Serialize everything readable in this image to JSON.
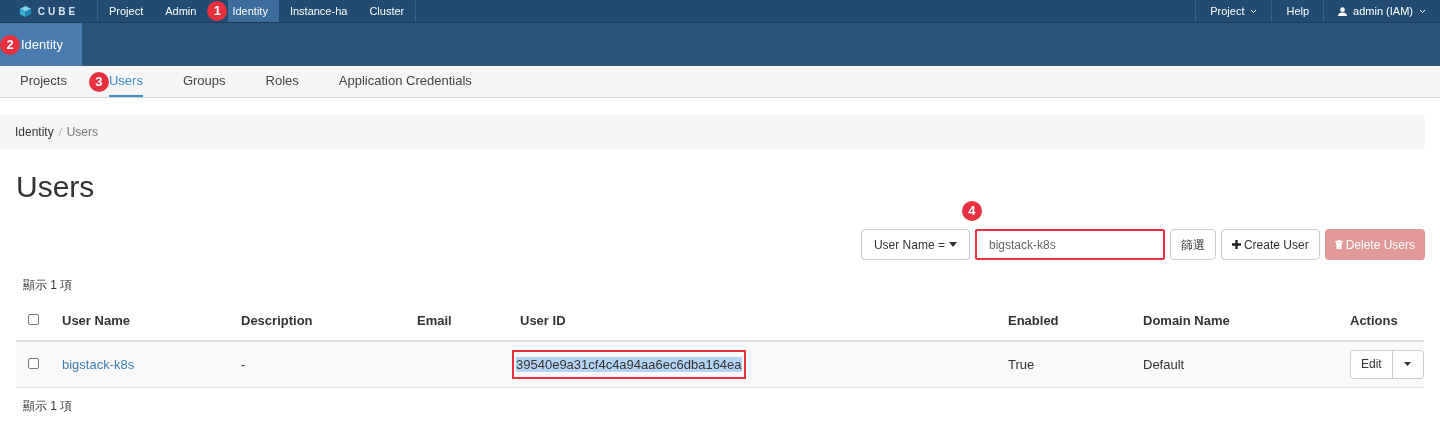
{
  "brand": {
    "name": "CUBE"
  },
  "top_nav": [
    {
      "label": "Project",
      "selected": false
    },
    {
      "label": "Admin",
      "selected": false
    },
    {
      "label": "Identity",
      "selected": true,
      "marker": "1"
    },
    {
      "label": "Instance-ha",
      "selected": false
    },
    {
      "label": "Cluster",
      "selected": false
    }
  ],
  "top_right": [
    {
      "label": "Project",
      "kind": "dropdown"
    },
    {
      "label": "Help",
      "kind": "link"
    },
    {
      "label": "admin (IAM)",
      "kind": "user"
    }
  ],
  "panel": {
    "label": "Identity",
    "selected": true,
    "marker": "2"
  },
  "tabs": [
    {
      "label": "Projects",
      "selected": false
    },
    {
      "label": "Users",
      "selected": true,
      "marker": "3"
    },
    {
      "label": "Groups",
      "selected": false
    },
    {
      "label": "Roles",
      "selected": false
    },
    {
      "label": "Application Credentials",
      "selected": false
    }
  ],
  "breadcrumb": [
    "Identity",
    "Users"
  ],
  "page_title": "Users",
  "toolbar": {
    "filter_select": "User Name =",
    "filter_value": "bigstack-k8s",
    "filter_annotated": true,
    "filter_marker": "4",
    "filter_button": "篩選",
    "create_button": "Create User",
    "delete_button": {
      "label": "Delete Users",
      "disabled": true
    }
  },
  "count_top": "顯示 1 項",
  "table": {
    "columns": [
      "User Name",
      "Description",
      "Email",
      "User ID",
      "Enabled",
      "Domain Name",
      "Actions"
    ],
    "select_all_checked": false,
    "rows": [
      {
        "checked": false,
        "user_name": "bigstack-k8s",
        "description": "-",
        "email": "",
        "user_id": "39540e9a31cf4c4a94aa6ec6dba164ea",
        "user_id_selected": true,
        "user_id_annotated": true,
        "enabled": "True",
        "domain": "Default",
        "action": "Edit"
      }
    ]
  },
  "count_bottom": "顯示 1 項"
}
